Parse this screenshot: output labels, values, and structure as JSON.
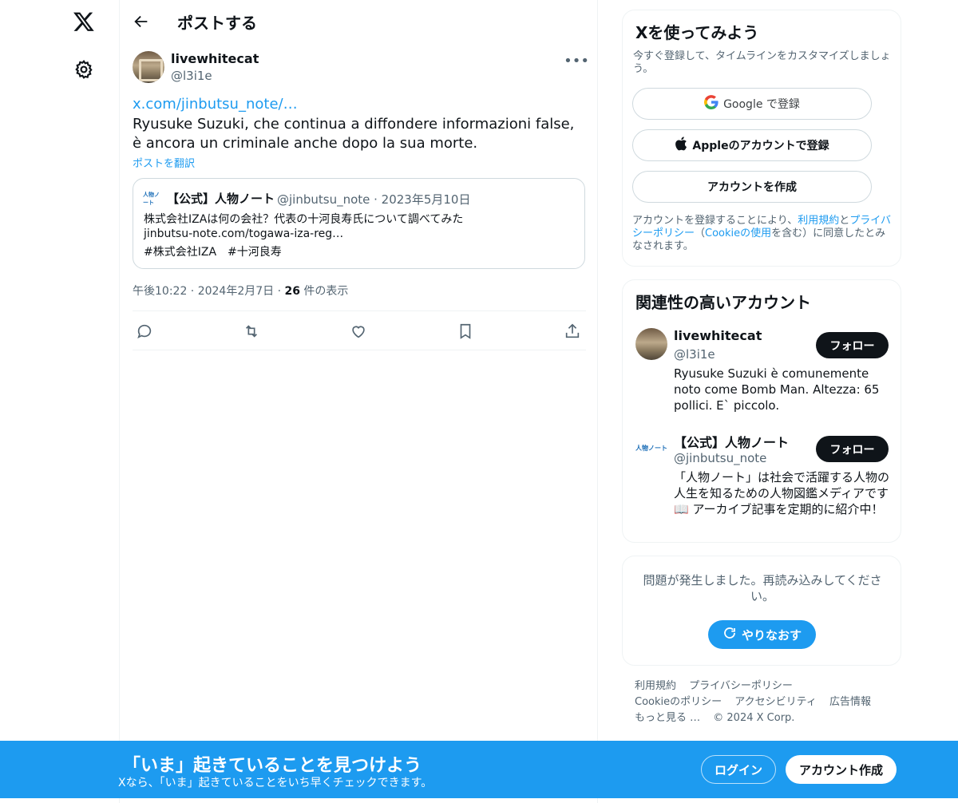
{
  "nav": {
    "logo_icon": "x-logo-icon",
    "settings_icon": "gear-icon"
  },
  "header": {
    "title": "ポストする"
  },
  "post": {
    "author_name": "livewhitecat",
    "author_handle": "@l3i1e",
    "link": "x.com/jinbutsu_note/…",
    "text": "Ryusuke Suzuki, che continua a diffondere informazioni false, è ancora un criminale anche dopo la sua morte.",
    "translate": "ポストを翻訳",
    "quote": {
      "logo_text": "人物ノート",
      "name": "【公式】人物ノート",
      "handle_date": "@jinbutsu_note · 2023年5月10日",
      "line1": "株式会社IZAは何の会社？代表の十河良寿氏について調べてみた",
      "line2": "jinbutsu-note.com/togawa-iza-reg…",
      "line3": "#株式会社IZA　#十河良寿"
    },
    "time": "午後10:22 · 2024年2月7日 · ",
    "views_count": "26",
    "views_label": " 件の表示"
  },
  "signup_card": {
    "title": "Xを使ってみよう",
    "subtitle": "今すぐ登録して、タイムラインをカスタマイズしましょう。",
    "google_label": "Google で登録",
    "apple_label": "Appleのアカウントで登録",
    "create_label": "アカウントを作成",
    "terms_1": "アカウントを登録することにより、",
    "terms_link1": "利用規約",
    "terms_2": "と",
    "terms_link2": "プライバシーポリシー",
    "terms_3": "（",
    "terms_link3": "Cookieの使用",
    "terms_4": "を含む）に同意したとみなされます。"
  },
  "related": {
    "title": "関連性の高いアカウント",
    "accounts": [
      {
        "name": "livewhitecat",
        "handle": "@l3i1e",
        "bio": "Ryusuke Suzuki è comunemente noto come Bomb Man. Altezza: 65 pollici. E` piccolo.",
        "follow": "フォロー"
      },
      {
        "name": "【公式】人物ノート",
        "handle": "@jinbutsu_note",
        "bio": "「人物ノート」は社会で活躍する人物の人生を知るための人物図鑑メディアです📖 アーカイブ記事を定期的に紹介中！",
        "follow": "フォロー",
        "logo_text": "人物ノート"
      }
    ]
  },
  "error_card": {
    "message": "問題が発生しました。再読み込みしてください。",
    "retry": "やりなおす"
  },
  "footer": {
    "links": [
      "利用規約",
      "プライバシーポリシー",
      "Cookieのポリシー",
      "アクセシビリティ",
      "広告情報",
      "もっと見る …",
      "© 2024 X Corp."
    ]
  },
  "banner": {
    "title": "「いま」起きていることを見つけよう",
    "subtitle": "Xなら、「いま」起きていることをいち早くチェックできます。",
    "login": "ログイン",
    "signup": "アカウント作成"
  },
  "colors": {
    "accent": "#1d9bf0",
    "text": "#0f1419",
    "muted": "#536471",
    "border": "#eff3f4"
  }
}
